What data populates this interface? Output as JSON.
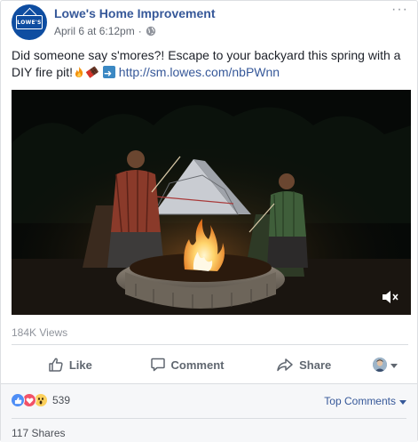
{
  "post": {
    "page_name": "Lowe's Home Improvement",
    "logo_text": "LOWE'S",
    "date": "April 6 at 6:12pm",
    "separator": "·",
    "more": "···",
    "text_main": "Did someone say s'mores?! Escape to your backyard this spring with a DIY fire pit!",
    "link": "http://sm.lowes.com/nbPWnn"
  },
  "video": {
    "views": "184K Views"
  },
  "actions": {
    "like": "Like",
    "comment": "Comment",
    "share": "Share"
  },
  "footer": {
    "reaction_count": "539",
    "top_comments": "Top Comments",
    "shares": "117 Shares"
  },
  "colors": {
    "brand_blue": "#0e4da1",
    "link": "#365899",
    "like": "#4e8ef6",
    "love": "#f25268",
    "wow": "#fcd05c"
  },
  "icons": [
    "globe-icon",
    "more-icon",
    "fire-emoji",
    "chocolate-emoji",
    "arrow-emoji",
    "mute-icon",
    "like-icon",
    "comment-icon",
    "share-icon",
    "caret-icon"
  ]
}
